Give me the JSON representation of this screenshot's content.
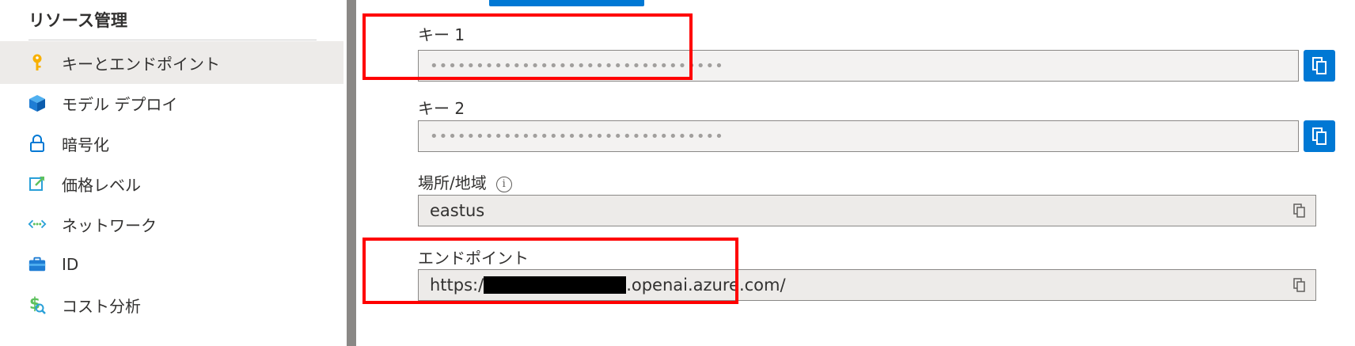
{
  "sidebar": {
    "title": "リソース管理",
    "items": [
      {
        "label": "キーとエンドポイント",
        "icon": "key-icon",
        "active": true
      },
      {
        "label": "モデル デプロイ",
        "icon": "cube-icon",
        "active": false
      },
      {
        "label": "暗号化",
        "icon": "lock-icon",
        "active": false
      },
      {
        "label": "価格レベル",
        "icon": "edit-external-icon",
        "active": false
      },
      {
        "label": "ネットワーク",
        "icon": "network-icon",
        "active": false
      },
      {
        "label": "ID",
        "icon": "identity-icon",
        "active": false
      },
      {
        "label": "コスト分析",
        "icon": "cost-analysis-icon",
        "active": false
      }
    ]
  },
  "main": {
    "key1": {
      "label": "キー 1",
      "value": "••••••••••••••••••••••••••••••••"
    },
    "key2": {
      "label": "キー 2",
      "value": "••••••••••••••••••••••••••••••••"
    },
    "location": {
      "label": "場所/地域",
      "info_glyph": "i",
      "value": "eastus"
    },
    "endpoint": {
      "label": "エンドポイント",
      "prefix": "https:/",
      "suffix": ".openai.azure.com/"
    }
  },
  "colors": {
    "accent": "#0078d4",
    "highlight": "#ff0000",
    "active_bg": "#edebe9"
  }
}
